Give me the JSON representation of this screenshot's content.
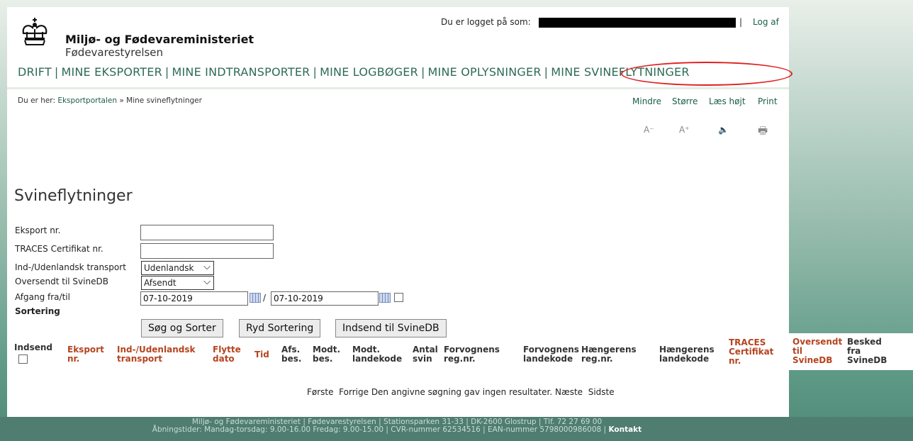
{
  "header": {
    "ministry": "Miljø- og Fødevareministeriet",
    "agency": "Fødevarestyrelsen",
    "logged_in_label": "Du er logget på som:",
    "separator": "|",
    "logout": "Log af"
  },
  "nav": {
    "items": [
      "DRIFT",
      "MINE EKSPORTER",
      "MINE INDTRANSPORTER",
      "MINE LOGBØGER",
      "MINE OPLYSNINGER",
      "MINE SVINEFLYTNINGER"
    ],
    "highlight_color": "#e02020"
  },
  "breadcrumb": {
    "prefix": "Du er her:",
    "home": "Eksportportalen",
    "arrow": "»",
    "current": "Mine svineflytninger"
  },
  "tools": {
    "smaller": "Mindre",
    "larger": "Større",
    "read_aloud": "Læs højt",
    "print": "Print",
    "icons": [
      "text-smaller-icon",
      "text-larger-icon",
      "speaker-icon",
      "printer-icon"
    ],
    "icon_glyphs": [
      "A⁻",
      "A⁺",
      "🔈",
      "🖶"
    ]
  },
  "page_title": "Svineflytninger",
  "form": {
    "export_no_label": "Eksport nr.",
    "export_no_value": "",
    "traces_label": "TRACES Certifikat nr.",
    "traces_value": "",
    "transport_label": "Ind-/Udenlandsk transport",
    "transport_value": "Udenlandsk",
    "sent_label": "Oversendt til SvineDB",
    "sent_value": "Afsendt",
    "departure_label": "Afgang fra/til",
    "date_from": "07-10-2019",
    "date_sep": "/",
    "date_to": "07-10-2019",
    "sort_label": "Sortering"
  },
  "buttons": {
    "search_sort": "Søg og Sorter",
    "clear_sort": "Ryd Sortering",
    "submit": "Indsend til SvineDB"
  },
  "table": {
    "columns": [
      {
        "l1": "Indsend",
        "l2": "",
        "l3": "",
        "link": false
      },
      {
        "l1": "Eksport",
        "l2": "nr.",
        "l3": "",
        "link": true
      },
      {
        "l1": "Ind-/Udenlandsk",
        "l2": "transport",
        "l3": "",
        "link": true
      },
      {
        "l1": "Flytte",
        "l2": "dato",
        "l3": "",
        "link": true
      },
      {
        "l1": "Tid",
        "l2": "",
        "l3": "",
        "link": true
      },
      {
        "l1": "Afs.",
        "l2": "bes.",
        "l3": "",
        "link": false
      },
      {
        "l1": "Modt.",
        "l2": "bes.",
        "l3": "",
        "link": false
      },
      {
        "l1": "Modt.",
        "l2": "landekode",
        "l3": "",
        "link": false
      },
      {
        "l1": "Antal",
        "l2": "svin",
        "l3": "",
        "link": false
      },
      {
        "l1": "Forvognens",
        "l2": "reg.nr.",
        "l3": "",
        "link": false
      },
      {
        "l1": "Forvognens",
        "l2": "landekode",
        "l3": "",
        "link": false
      },
      {
        "l1": "Hængerens",
        "l2": "reg.nr.",
        "l3": "",
        "link": false
      },
      {
        "l1": "Hængerens",
        "l2": "landekode",
        "l3": "",
        "link": false
      },
      {
        "l1": "TRACES",
        "l2": "Certifikat",
        "l3": "nr.",
        "link": true
      },
      {
        "l1": "Oversendt",
        "l2": "til",
        "l3": "SvineDB",
        "link": true
      },
      {
        "l1": "Besked",
        "l2": "fra",
        "l3": "SvineDB",
        "link": false
      }
    ]
  },
  "pager": {
    "first": "Første",
    "prev": "Forrige",
    "message": "Den angivne søgning gav ingen resultater.",
    "next": "Næste",
    "last": "Sidste"
  },
  "footer": {
    "line1": "Miljø- og Fødevareministeriet | Fødevarestyrelsen | Stationsparken 31-33 | DK-2600 Glostrup | Tlf. 72 27 69 00",
    "line2": "Åbningstider: Mandag-torsdag: 9.00-16.00 Fredag: 9.00-15.00 | CVR-nummer 62534516 | EAN-nummer 5798000986008 |",
    "contact": "Kontakt"
  },
  "colors": {
    "nav": "#2f6b54",
    "link_header": "#b5441f",
    "footer_bg": "#4f7d6f"
  }
}
